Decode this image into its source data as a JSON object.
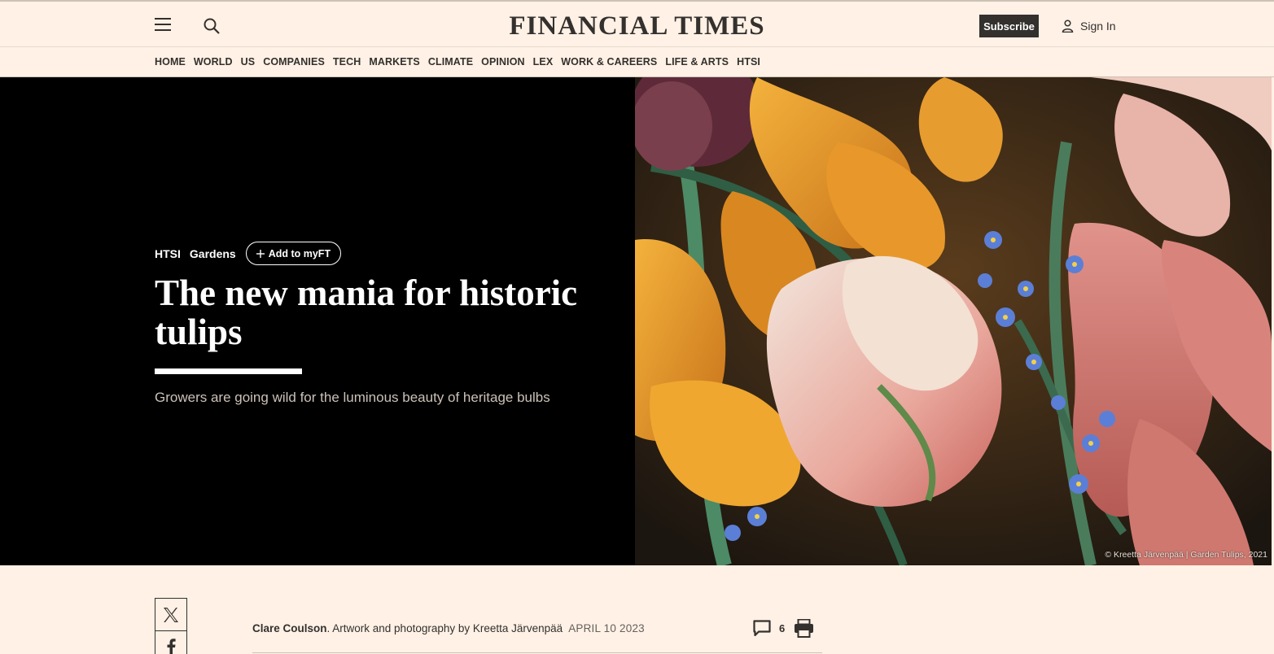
{
  "header": {
    "logo": "FINANCIAL TIMES",
    "subscribe_label": "Subscribe",
    "signin_label": "Sign In"
  },
  "nav": {
    "items": [
      "HOME",
      "WORLD",
      "US",
      "COMPANIES",
      "TECH",
      "MARKETS",
      "CLIMATE",
      "OPINION",
      "LEX",
      "WORK & CAREERS",
      "LIFE & ARTS",
      "HTSI"
    ]
  },
  "article": {
    "tags": [
      "HTSI",
      "Gardens"
    ],
    "add_myft_label": "Add to myFT",
    "headline": "The new mania for historic tulips",
    "standfirst": "Growers are going wild for the luminous beauty of heritage bulbs",
    "image_credit": "© Kreetta Järvenpää | Garden Tulips, 2021",
    "author": "Clare Coulson",
    "byline_rest": ". Artwork and photography by Kreetta Järvenpää",
    "date": "APRIL 10 2023",
    "comment_count": "6"
  },
  "colors": {
    "background": "#fff1e5",
    "hero_left": "#000000",
    "subscribe_bg": "#33302e",
    "text": "#33302e"
  },
  "icons": [
    "menu-icon",
    "search-icon",
    "user-icon",
    "plus-icon",
    "x-twitter-icon",
    "facebook-icon",
    "comment-icon",
    "print-icon"
  ]
}
